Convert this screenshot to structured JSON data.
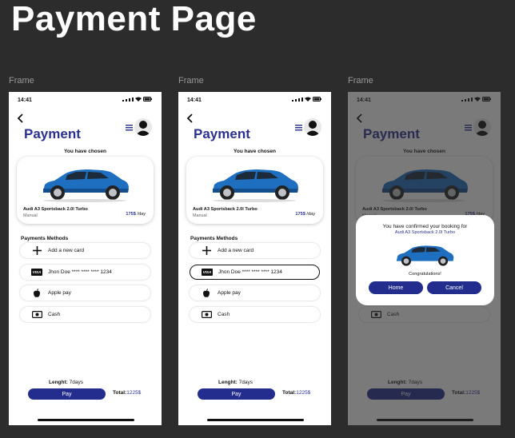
{
  "page_title": "Payment Page",
  "frame_label": "Frame",
  "status": {
    "time": "14:41"
  },
  "screen": {
    "title": "Payment",
    "chosen_label": "You have chosen",
    "car": {
      "name": "Audi A3 Sportsback 2.0l Turbo",
      "transmission": "Manual",
      "price": "175$",
      "unit": "/day"
    },
    "methods_title": "Payments Methods",
    "methods": [
      "Add a new card",
      "Jhon Doe **** **** **** 1234",
      "Apple pay",
      "Cash"
    ],
    "visa_text": "VISA",
    "length_label": "Lenght:",
    "length_value": "7days",
    "pay_label": "Pay",
    "total_label": "Total:",
    "total_value": "1225$"
  },
  "dialog": {
    "line1": "You have confirmed your booking for",
    "line2": "Audi A3 Sportsback 2.0l Turbo",
    "congrats": "Congratulations!",
    "home_label": "Home",
    "cancel_label": "Cancel"
  },
  "colors": {
    "brand": "#2a3190",
    "button": "#232d8e",
    "car": "#1f6fc1",
    "background": "#2c2c2c"
  },
  "icons": [
    "back-arrow-icon",
    "menu-icon",
    "plus-icon",
    "visa-icon",
    "apple-icon",
    "cash-icon"
  ],
  "selected_method_frame2": "Jhon Doe **** **** **** 1234"
}
